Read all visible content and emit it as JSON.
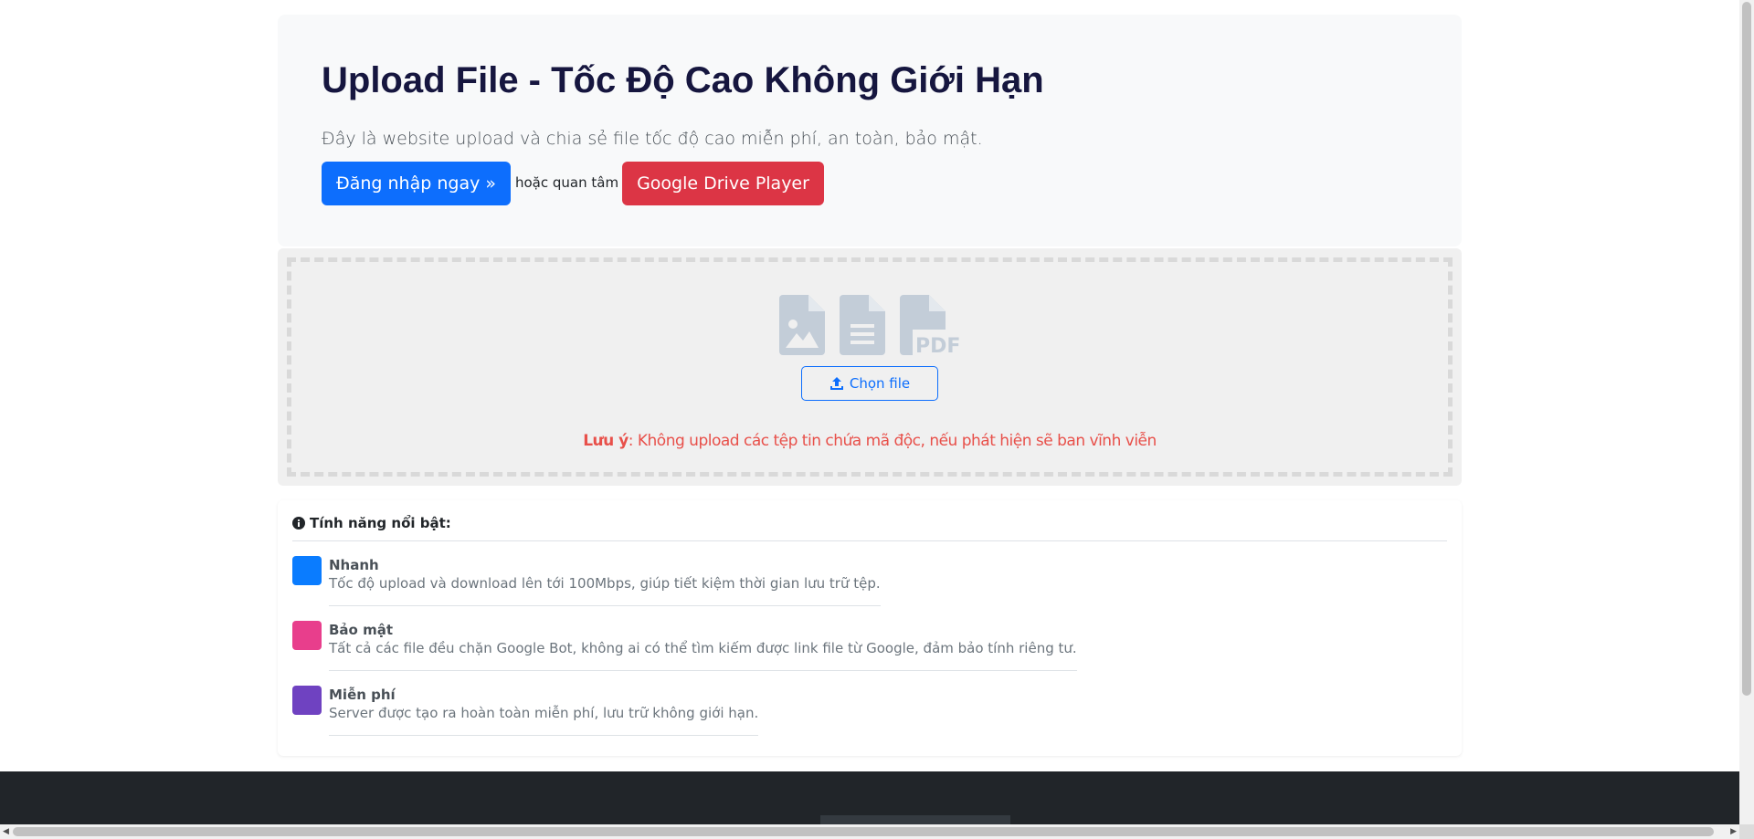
{
  "hero": {
    "title": "Upload File - Tốc Độ Cao Không Giới Hạn",
    "lead": "Đây là website upload và chia sẻ file tốc độ cao miễn phí, an toàn, bảo mật.",
    "login_button": "Đăng nhập ngay »",
    "or_text": "hoặc quan tâm",
    "drive_button": "Google Drive Player"
  },
  "upload": {
    "choose_label": "Chọn file",
    "warning_bold": "Lưu ý",
    "warning_text": ": Không upload các tệp tin chứa mã độc, nếu phát hiện sẽ ban vĩnh viễn",
    "icons": [
      "file-image-icon",
      "file-lines-icon",
      "file-pdf-icon"
    ]
  },
  "features": {
    "heading": "Tính năng nổi bật:",
    "items": [
      {
        "title": "Nhanh",
        "desc": "Tốc độ upload và download lên tới 100Mbps, giúp tiết kiệm thời gian lưu trữ tệp.",
        "color": "#0a7cff"
      },
      {
        "title": "Bảo mật",
        "desc": "Tất cả các file đều chặn Google Bot, không ai có thể tìm kiếm được link file từ Google, đảm bảo tính riêng tư.",
        "color": "#e83e8c"
      },
      {
        "title": "Miễn phí",
        "desc": "Server được tạo ra hoàn toàn miễn phí, lưu trữ không giới hạn.",
        "color": "#6f42c1"
      }
    ]
  },
  "colors": {
    "primary": "#0d6efd",
    "danger": "#dc3545",
    "warning_text": "#e8504a",
    "footer": "#212529"
  }
}
